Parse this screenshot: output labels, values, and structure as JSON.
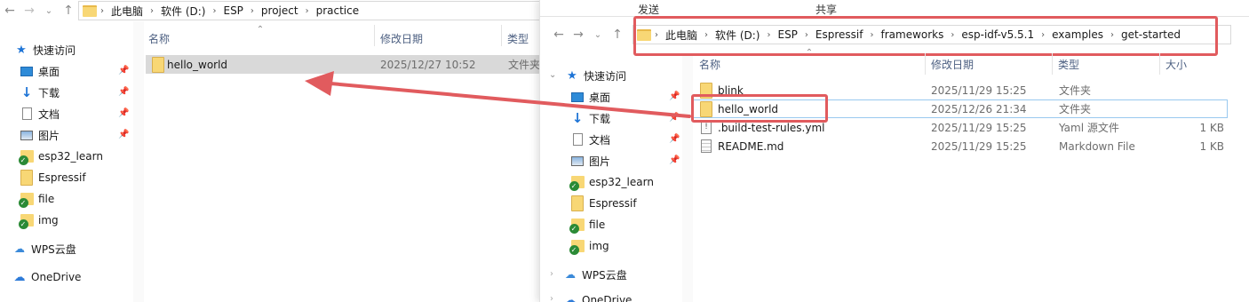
{
  "left": {
    "breadcrumb": [
      "此电脑",
      "软件 (D:)",
      "ESP",
      "project",
      "practice"
    ],
    "sidebar": {
      "quick_access": "快速访问",
      "pinned": [
        {
          "label": "桌面",
          "icon": "desktop-icon"
        },
        {
          "label": "下载",
          "icon": "download-icon"
        },
        {
          "label": "文档",
          "icon": "document-icon"
        },
        {
          "label": "图片",
          "icon": "picture-icon"
        }
      ],
      "folders": [
        {
          "label": "esp32_learn",
          "icon": "synced-folder-icon"
        },
        {
          "label": "Espressif",
          "icon": "folder-icon"
        },
        {
          "label": "file",
          "icon": "synced-folder-icon"
        },
        {
          "label": "img",
          "icon": "synced-folder-icon"
        }
      ],
      "wps": "WPS云盘",
      "onedrive": "OneDrive"
    },
    "columns": {
      "name": "名称",
      "modified": "修改日期",
      "type": "类型"
    },
    "rows": [
      {
        "name": "hello_world",
        "modified": "2025/12/27 10:52",
        "type": "文件夹"
      }
    ]
  },
  "right": {
    "ribbon": {
      "tab1": "发送",
      "tab2": "共享"
    },
    "breadcrumb": [
      "此电脑",
      "软件 (D:)",
      "ESP",
      "Espressif",
      "frameworks",
      "esp-idf-v5.5.1",
      "examples",
      "get-started"
    ],
    "sidebar": {
      "quick_access": "快速访问",
      "pinned": [
        {
          "label": "桌面"
        },
        {
          "label": "下载"
        },
        {
          "label": "文档"
        },
        {
          "label": "图片"
        }
      ],
      "folders": [
        {
          "label": "esp32_learn"
        },
        {
          "label": "Espressif"
        },
        {
          "label": "file"
        },
        {
          "label": "img"
        }
      ],
      "wps": "WPS云盘",
      "onedrive": "OneDrive"
    },
    "columns": {
      "name": "名称",
      "modified": "修改日期",
      "type": "类型",
      "size": "大小"
    },
    "rows": [
      {
        "name": "blink",
        "modified": "2025/11/29 15:25",
        "type": "文件夹",
        "size": ""
      },
      {
        "name": "hello_world",
        "modified": "2025/12/26 21:34",
        "type": "文件夹",
        "size": ""
      },
      {
        "name": ".build-test-rules.yml",
        "modified": "2025/11/29 15:25",
        "type": "Yaml 源文件",
        "size": "1 KB"
      },
      {
        "name": "README.md",
        "modified": "2025/11/29 15:25",
        "type": "Markdown File",
        "size": "1 KB"
      }
    ]
  },
  "colors": {
    "highlight": "#e15b5e",
    "selected_row": "#d9d9d9",
    "folder": "#f8d775"
  }
}
